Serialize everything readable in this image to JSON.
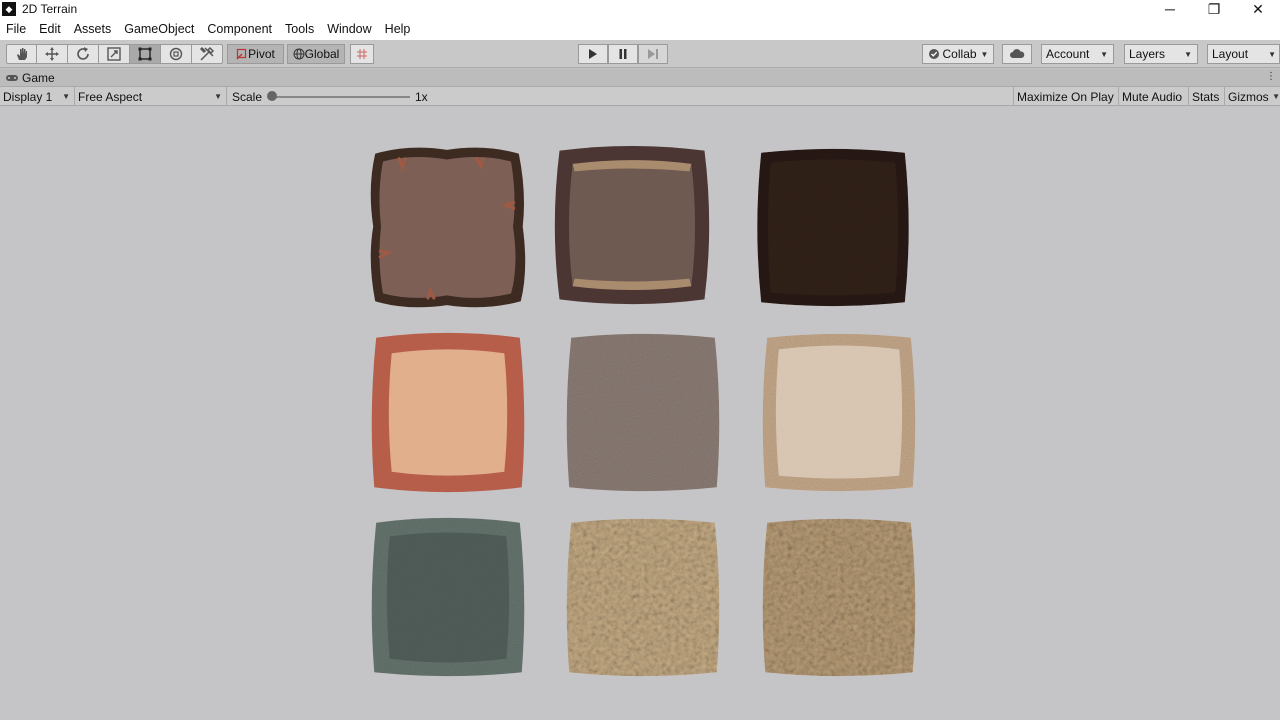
{
  "window": {
    "title": "2D Terrain"
  },
  "menu": [
    "File",
    "Edit",
    "Assets",
    "GameObject",
    "Component",
    "Tools",
    "Window",
    "Help"
  ],
  "toolbar": {
    "tools": [
      "hand-tool-icon",
      "move-tool-icon",
      "rotate-tool-icon",
      "scale-tool-icon",
      "rect-tool-icon",
      "transform-tool-icon",
      "custom-tool-icon"
    ],
    "pivot_label": "Pivot",
    "global_label": "Global",
    "collab_label": "Collab",
    "account_label": "Account",
    "layers_label": "Layers",
    "layout_label": "Layout"
  },
  "game_tab": {
    "label": "Game"
  },
  "game_bar": {
    "display": "Display 1",
    "aspect": "Free Aspect",
    "scale_label": "Scale",
    "scale_value": "1x",
    "maximize_label": "Maximize On Play",
    "mute_label": "Mute Audio",
    "stats_label": "Stats",
    "gizmos_label": "Gizmos"
  },
  "tiles": [
    {
      "name": "cartoon-dirt-tile",
      "colors": [
        "#7b5e55",
        "#3c2a22"
      ]
    },
    {
      "name": "cartoon-stone-tile",
      "colors": [
        "#6e5a52",
        "#4a3634"
      ]
    },
    {
      "name": "dark-soil-tile",
      "colors": [
        "#2c1d16",
        "#1e130e"
      ]
    },
    {
      "name": "sand-tile",
      "colors": [
        "#e0ad8b",
        "#b75f48"
      ]
    },
    {
      "name": "gravel-tile",
      "colors": [
        "#8f8079",
        "#6f625c"
      ]
    },
    {
      "name": "pale-sand-tile",
      "colors": [
        "#dcc9b6",
        "#c0a283"
      ]
    },
    {
      "name": "mossy-rock-tile",
      "colors": [
        "#4d5955",
        "#6f8077"
      ]
    },
    {
      "name": "pebble-tile",
      "colors": [
        "#a78f6c",
        "#5c4832"
      ]
    },
    {
      "name": "pebble-tile-2",
      "colors": [
        "#9a8262",
        "#4f3c28"
      ]
    }
  ]
}
